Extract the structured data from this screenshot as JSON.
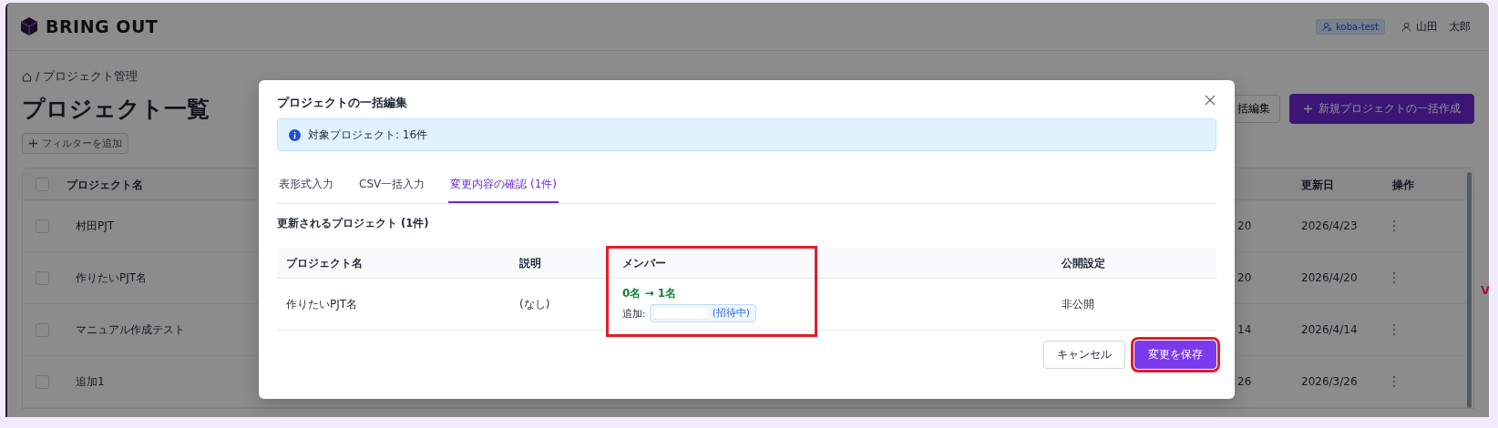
{
  "header": {
    "logo": "BRING OUT",
    "workspace_badge": "koba-test",
    "user_name": "山田　太郎"
  },
  "breadcrumb": "/ プロジェクト管理",
  "page_title": "プロジェクト一覧",
  "toolbar_buttons": [
    {
      "label": "括編集",
      "kind": "secondary"
    },
    {
      "label": "新規プロジェクトの一括作成",
      "kind": "primary"
    }
  ],
  "filter_button": "フィルターを追加",
  "table": {
    "header_checked": false,
    "columns": [
      {
        "label": "プロジェクト名"
      },
      {
        "label": "更新日"
      },
      {
        "label": "操作"
      }
    ],
    "rows": [
      {
        "checked": false,
        "name": "村田PJT",
        "column_2": "20",
        "updated": "2026/4/23"
      },
      {
        "checked": false,
        "name": "作りたいPJT名",
        "column_2": "20",
        "updated": "2026/4/20"
      },
      {
        "checked": false,
        "name": "マニュアル作成テスト",
        "column_2": "14",
        "updated": "2026/4/14"
      },
      {
        "checked": false,
        "name": "追加1",
        "column_2": "26",
        "updated": "2026/3/26"
      }
    ]
  },
  "edge_mark": "V",
  "modal": {
    "title": "プロジェクトの一括編集",
    "info": "対象プロジェクト: 16件",
    "tabs": [
      {
        "label": "表形式入力",
        "selected": false
      },
      {
        "label": "CSV一括入力",
        "selected": false
      },
      {
        "label": "変更内容の確認 (1件)",
        "selected": true
      }
    ],
    "section_title": "更新されるプロジェクト (1件)",
    "table": {
      "columns": [
        {
          "label": "プロジェクト名",
          "highlighted": false
        },
        {
          "label": "説明",
          "highlighted": false
        },
        {
          "label": "メンバー",
          "highlighted": true
        },
        {
          "label": "公開設定",
          "highlighted": false
        }
      ],
      "rows": [
        {
          "name": "作りたいPJT名",
          "description": "(なし)",
          "member_change": "0名 → 1名",
          "added_label": "追加:",
          "invite_status": "(招待中)",
          "visibility": "非公開"
        }
      ]
    },
    "buttons": [
      {
        "label": "キャンセル",
        "kind": "secondary",
        "highlighted": false
      },
      {
        "label": "変更を保存",
        "kind": "primary",
        "highlighted": true
      }
    ]
  }
}
